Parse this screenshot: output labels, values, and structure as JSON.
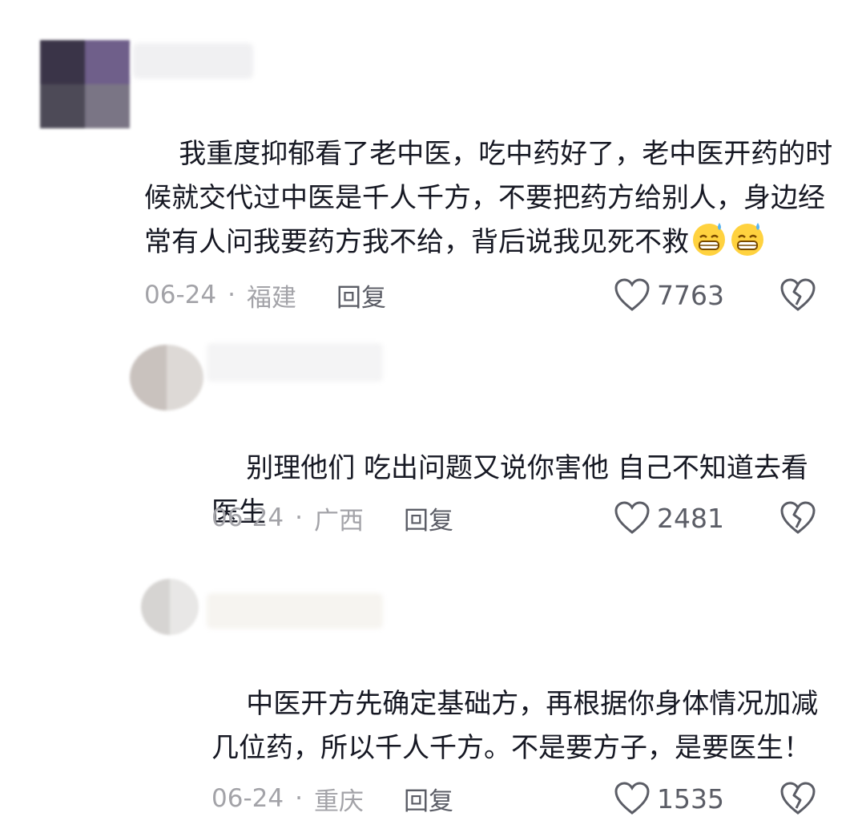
{
  "comments": [
    {
      "text": "我重度抑郁看了老中医，吃中药好了，老中医开药的时候就交代过中医是千人千方，不要把药方给别人，身边经常有人问我要药方我不给，背后说我见死不救",
      "emoji": [
        "grinning-sweat-emoji",
        "grinning-sweat-emoji"
      ],
      "date": "06-24",
      "separator": "·",
      "location": "福建",
      "reply_label": "回复",
      "likes": "7763"
    },
    {
      "text": "别理他们 吃出问题又说你害他 自己不知道去看医生",
      "date": "06-24",
      "separator": "·",
      "location": "广西",
      "reply_label": "回复",
      "likes": "2481"
    },
    {
      "text": "中医开方先确定基础方，再根据你身体情况加减几位药，所以千人千方。不是要方子，是要医生！",
      "date": "06-24",
      "separator": "·",
      "location": "重庆",
      "reply_label": "回复",
      "likes": "1535"
    }
  ],
  "colors": {
    "text": "#161823",
    "meta": "#a3a3a8",
    "action": "#5b5d66"
  }
}
